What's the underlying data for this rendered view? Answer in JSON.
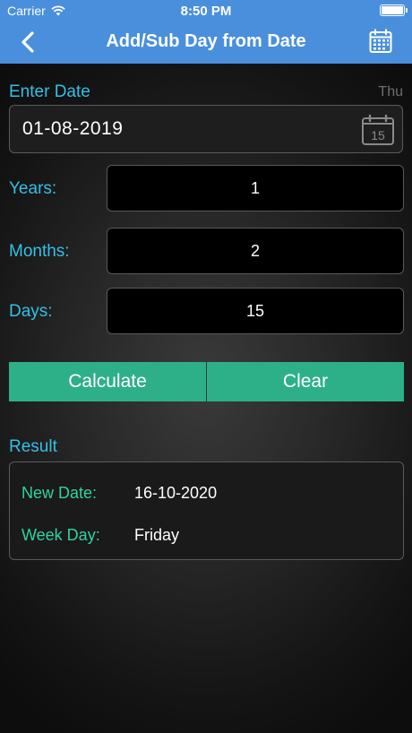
{
  "status_bar": {
    "carrier": "Carrier",
    "time": "8:50 PM"
  },
  "nav": {
    "title": "Add/Sub Day from Date",
    "back_icon": "chevron-left-icon",
    "calendar_icon": "calendar-icon"
  },
  "date_section": {
    "label": "Enter Date",
    "weekday_hint": "Thu",
    "date_value": "01-08-2019",
    "calendar_day": "15"
  },
  "fields": {
    "years": {
      "label": "Years:",
      "value": "1"
    },
    "months": {
      "label": "Months:",
      "value": "2"
    },
    "days": {
      "label": "Days:",
      "value": "15"
    }
  },
  "buttons": {
    "calculate": "Calculate",
    "clear": "Clear"
  },
  "result": {
    "label": "Result",
    "new_date_label": "New Date:",
    "new_date_value": "16-10-2020",
    "week_day_label": "Week Day:",
    "week_day_value": "Friday"
  },
  "colors": {
    "nav": "#4a8fdc",
    "accent_cyan": "#33c0e6",
    "button": "#2db088",
    "result_label": "#2ed3a0"
  }
}
